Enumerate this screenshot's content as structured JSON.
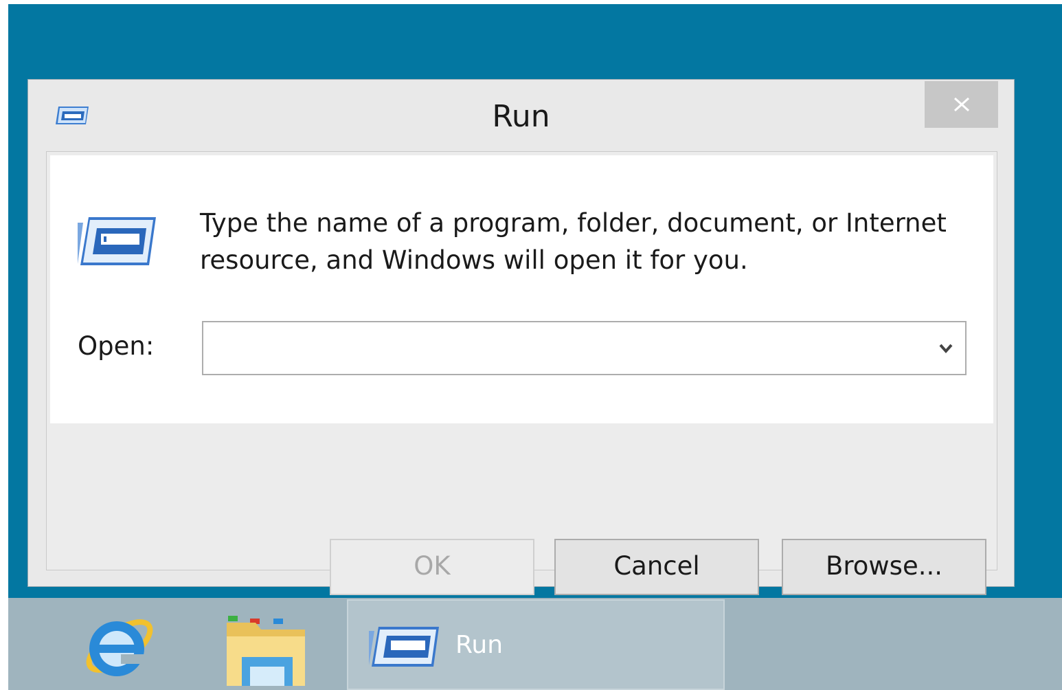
{
  "dialog": {
    "title": "Run",
    "close_glyph": "✕",
    "description": "Type the name of a program, folder, document, or Internet resource, and Windows will open it for you.",
    "open_label": "Open:",
    "open_value": "",
    "buttons": {
      "ok": "OK",
      "cancel": "Cancel",
      "browse": "Browse..."
    },
    "icon": "run-icon"
  },
  "taskbar": {
    "items": [
      {
        "icon": "internet-explorer-icon",
        "label": ""
      },
      {
        "icon": "file-explorer-icon",
        "label": ""
      },
      {
        "icon": "run-icon",
        "label": "Run"
      }
    ]
  },
  "colors": {
    "desktop": "#0377a1",
    "taskbar": "#9fb4be",
    "dialog": "#e9e9e9"
  }
}
